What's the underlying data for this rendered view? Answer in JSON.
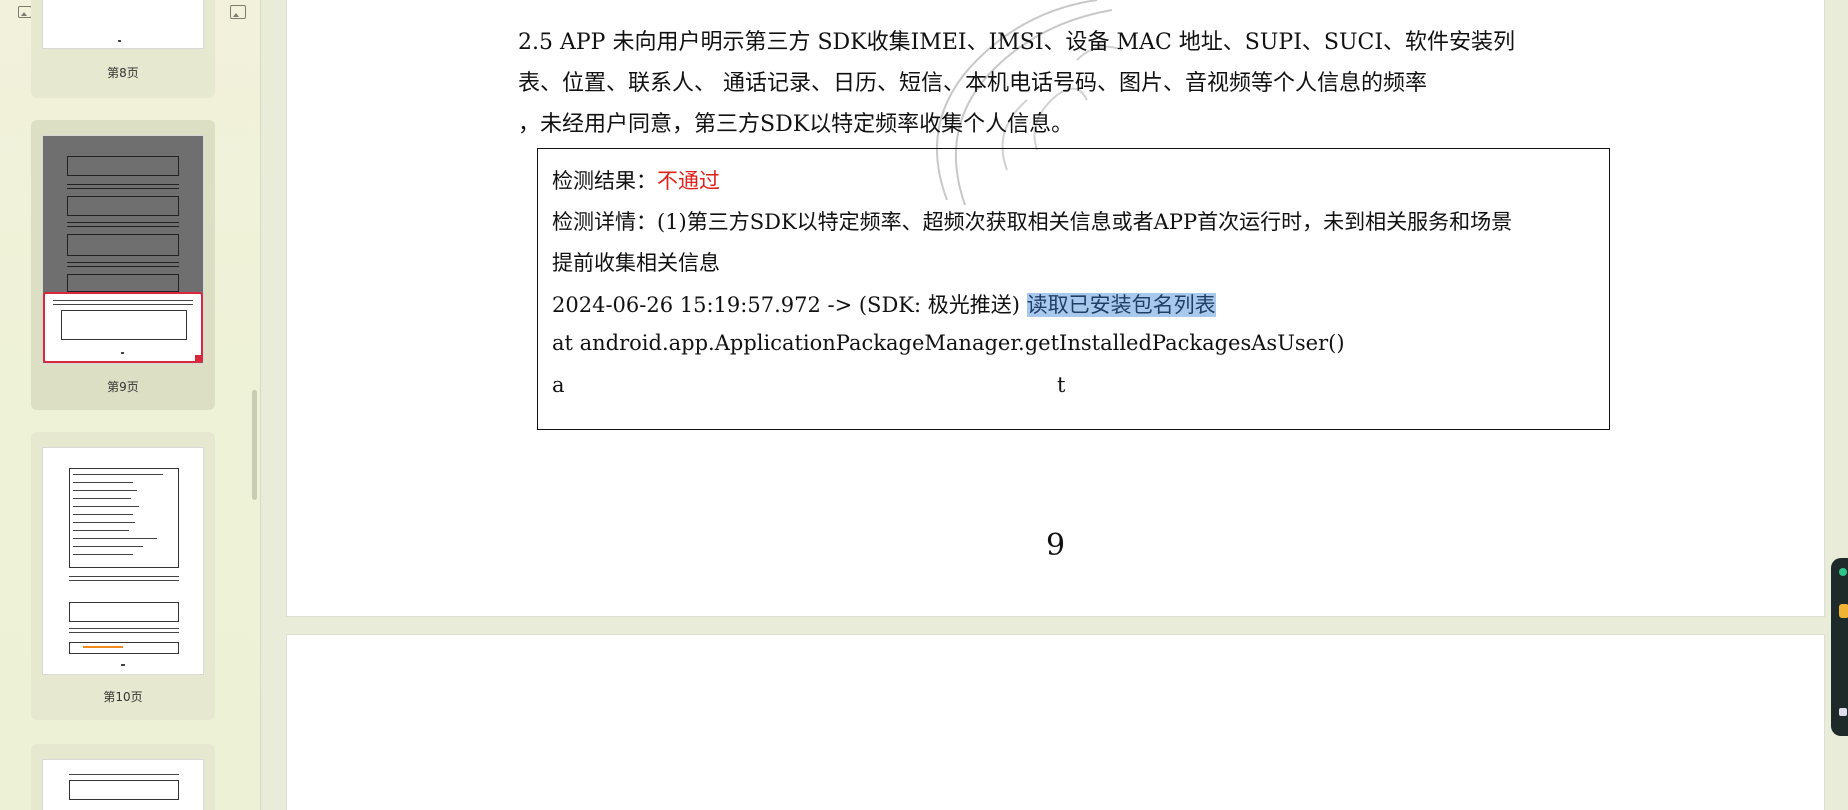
{
  "sidebar": {
    "zoom": {
      "level": 0.12
    },
    "thumbnails": [
      {
        "label": "第8页"
      },
      {
        "label": "第9页",
        "active": true
      },
      {
        "label": "第10页"
      }
    ]
  },
  "document": {
    "section": {
      "line1": "2.5 APP 未向用户明示第三方 SDK收集IMEI、IMSI、设备 MAC 地址、SUPI、SUCI、软件安装列",
      "line2": "表、位置、联系人、 通话记录、日历、短信、本机电话号码、图片、音视频等个人信息的频率",
      "line3": "，未经用户同意，第三方SDK以特定频率收集个人信息。"
    },
    "result": {
      "result_label": "检测结果：",
      "result_value": "不通过",
      "detail_line1": "检测详情：(1)第三方SDK以特定频率、超频次获取相关信息或者APP首次运行时，未到相关服务和场景",
      "detail_line2": "提前收集相关信息",
      "log_prefix": "2024-06-26 15:19:57.972 -> (SDK: 极光推送) ",
      "log_highlight": "读取已安装包名列表",
      "stack_line": "at android.app.ApplicationPackageManager.getInstalledPackagesAsUser()",
      "trail_a": "a",
      "trail_t": "t"
    },
    "page_number": "9"
  },
  "colors": {
    "fail_red": "#e0201b",
    "highlight": "#a9c9ec",
    "accent_blue": "#4a8fe0",
    "active_thumb_border": "#d9283b"
  },
  "icons": [
    "image-small-icon",
    "image-large-icon"
  ]
}
